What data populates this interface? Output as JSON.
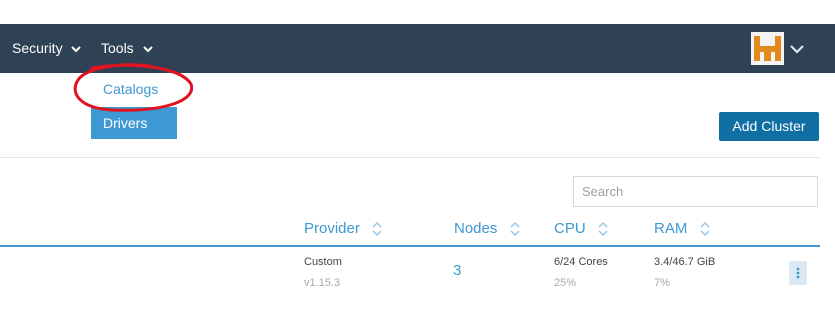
{
  "navbar": {
    "items": [
      {
        "label": "Security"
      },
      {
        "label": "Tools"
      }
    ]
  },
  "tools_menu": {
    "items": [
      {
        "label": "Catalogs"
      },
      {
        "label": "Drivers"
      }
    ]
  },
  "toolbar": {
    "add_cluster_label": "Add Cluster"
  },
  "search": {
    "placeholder": "Search",
    "value": ""
  },
  "table": {
    "columns": [
      "Provider",
      "Nodes",
      "CPU",
      "RAM"
    ],
    "rows": [
      {
        "provider": "Custom",
        "provider_version": "v1.15.3",
        "nodes": "3",
        "cpu": "6/24 Cores",
        "cpu_pct": "25%",
        "ram": "3.4/46.7 GiB",
        "ram_pct": "7%"
      }
    ]
  },
  "colors": {
    "navbar": "#2f4155",
    "accent": "#3d98d3",
    "primary_button": "#0f6fa3",
    "annotation": "#e0141e",
    "avatar_orange": "#e08a1e"
  }
}
